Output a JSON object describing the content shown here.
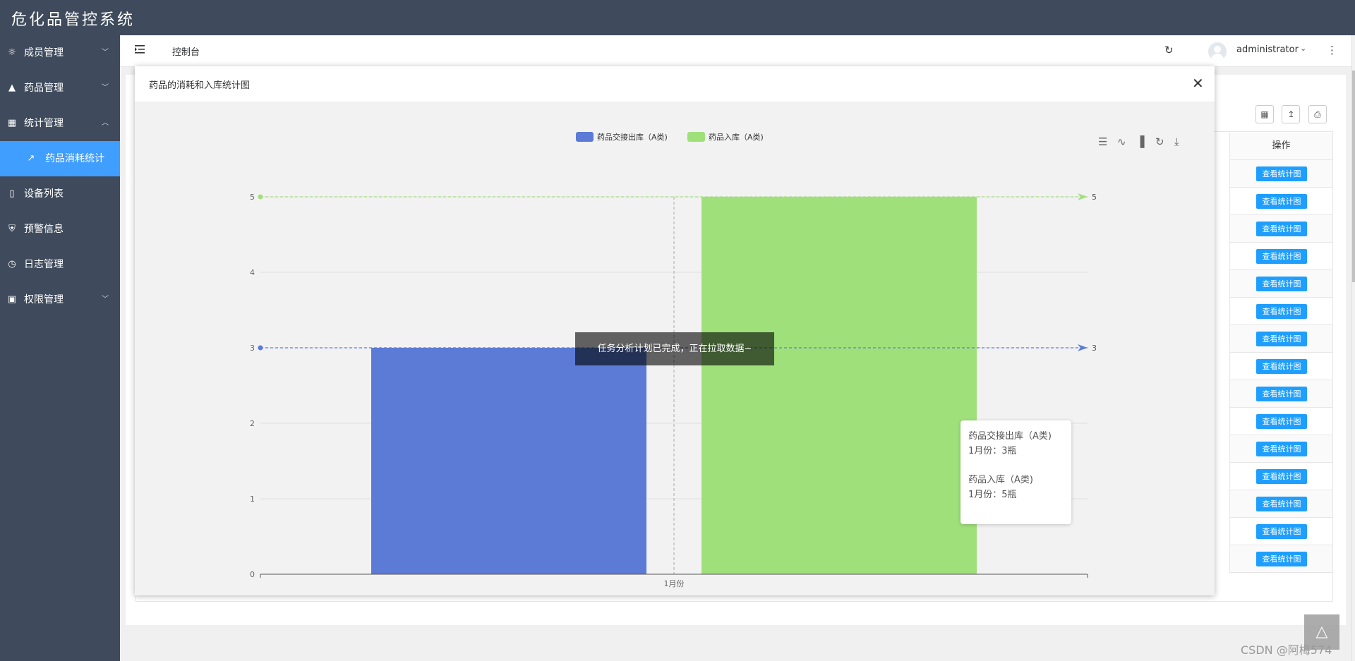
{
  "app": {
    "title": "危化品管控系统"
  },
  "sidebar": {
    "items": [
      {
        "label": "成员管理",
        "icon": "user-icon",
        "chevron": "﹀"
      },
      {
        "label": "药品管理",
        "icon": "flask-icon",
        "chevron": "﹀"
      },
      {
        "label": "统计管理",
        "icon": "bar-chart-icon",
        "chevron": "︿"
      },
      {
        "label": "药品消耗统计",
        "icon": "line-chart-icon",
        "chevron": ""
      },
      {
        "label": "设备列表",
        "icon": "device-icon",
        "chevron": ""
      },
      {
        "label": "预警信息",
        "icon": "shield-icon",
        "chevron": ""
      },
      {
        "label": "日志管理",
        "icon": "clock-icon",
        "chevron": ""
      },
      {
        "label": "权限管理",
        "icon": "lock-icon",
        "chevron": "﹀"
      }
    ]
  },
  "header": {
    "breadcrumb": "控制台",
    "username": "administrator"
  },
  "table": {
    "operation_header": "操作",
    "row_button": "查看统计图",
    "row_count": 15
  },
  "modal": {
    "title": "药品的消耗和入库统计图"
  },
  "toast": {
    "message": "任务分析计划已完成，正在拉取数据~"
  },
  "tooltip": {
    "series1_name": "药品交接出库（A类)",
    "series1_value": "1月份：3瓶",
    "series2_name": "药品入库（A类)",
    "series2_value": "1月份：5瓶"
  },
  "watermark": "CSDN @阿梅574",
  "colors": {
    "series1": "#5b7bd7",
    "series2": "#a0e07b",
    "topbar": "#3f4b5c",
    "active": "#409eff",
    "button": "#1e9fff"
  },
  "chart_data": {
    "type": "bar",
    "title": "",
    "xlabel": "",
    "ylabel": "",
    "categories": [
      "1月份"
    ],
    "series": [
      {
        "name": "药品交接出库（A类)",
        "values": [
          3
        ],
        "color": "#5b7bd7",
        "max_label": "3"
      },
      {
        "name": "药品入库（A类)",
        "values": [
          5
        ],
        "color": "#a0e07b",
        "max_label": "5"
      }
    ],
    "ylim": [
      0,
      5
    ],
    "yticks": [
      "0",
      "1",
      "2",
      "3",
      "4",
      "5"
    ],
    "grid": true,
    "legend": "top-center",
    "markline": "max"
  }
}
